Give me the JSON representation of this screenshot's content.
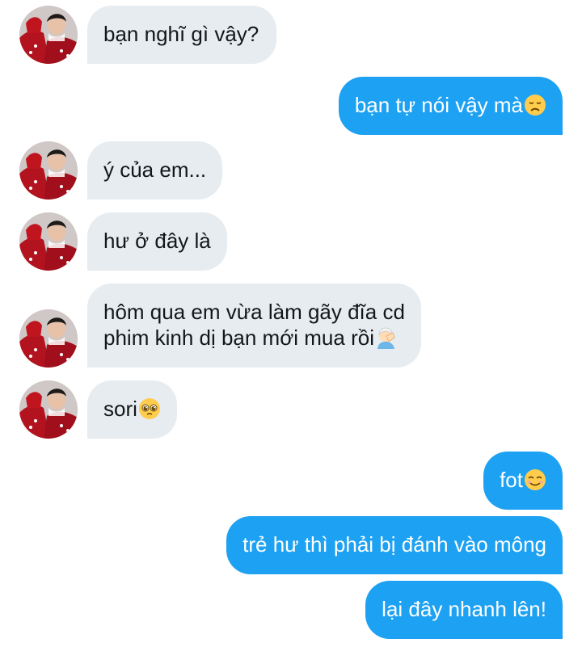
{
  "conversation": {
    "messages": [
      {
        "side": "received",
        "text": "bạn nghĩ gì vậy?"
      },
      {
        "side": "sent",
        "text": "bạn tự nói vậy mà",
        "emoji": "disappointed-face-emoji"
      },
      {
        "side": "received",
        "text": "ý của em..."
      },
      {
        "side": "received",
        "text": "hư ở đây là"
      },
      {
        "side": "received",
        "lines": [
          "hôm qua em vừa làm gãy đĩa cd",
          "phim kinh dị bạn mới mua rồi"
        ],
        "emoji": "person-facepalming-emoji"
      },
      {
        "side": "received",
        "text": "sori",
        "emoji": "pleading-face-emoji"
      },
      {
        "side": "sent",
        "text": "fot",
        "emoji": "smiling-face-emoji"
      },
      {
        "side": "sent",
        "text": "trẻ hư thì phải bị đánh vào mông"
      },
      {
        "side": "sent",
        "text": "lại đây nhanh lên!"
      }
    ]
  },
  "colors": {
    "received_bubble": "#e6ecf0",
    "received_text": "#14171a",
    "sent_bubble": "#1da1f2",
    "sent_text": "#ffffff"
  }
}
